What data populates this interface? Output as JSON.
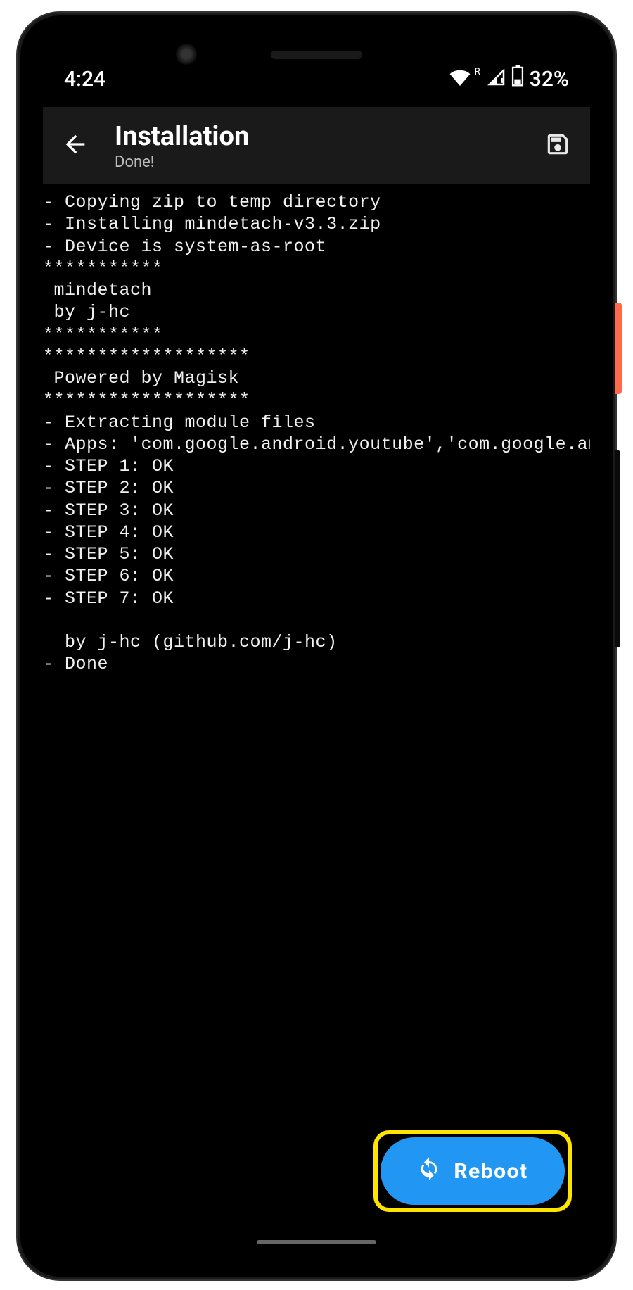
{
  "status_bar": {
    "time": "4:24",
    "roaming_indicator": "R",
    "battery_percent": "32%"
  },
  "app_bar": {
    "title": "Installation",
    "subtitle": "Done!"
  },
  "console": {
    "text": "- Copying zip to temp directory\n- Installing mindetach-v3.3.zip\n- Device is system-as-root\n***********\n mindetach\n by j-hc\n***********\n*******************\n Powered by Magisk\n*******************\n- Extracting module files\n- Apps: 'com.google.android.youtube','com.google.andro\n- STEP 1: OK\n- STEP 2: OK\n- STEP 3: OK\n- STEP 4: OK\n- STEP 5: OK\n- STEP 6: OK\n- STEP 7: OK\n\n  by j-hc (github.com/j-hc)\n- Done"
  },
  "fab": {
    "label": "Reboot"
  },
  "colors": {
    "accent": "#2196f3",
    "highlight_border": "#ffe400",
    "power_button": "#ff6b4a"
  }
}
